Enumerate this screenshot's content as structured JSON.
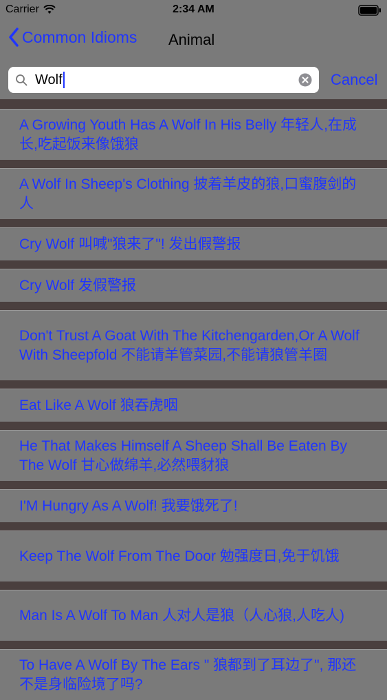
{
  "status_bar": {
    "carrier": "Carrier",
    "time": "2:34 AM"
  },
  "nav": {
    "back_label": "Common Idioms",
    "title": "Animal"
  },
  "search": {
    "value": "Wolf",
    "cancel_label": "Cancel"
  },
  "results": [
    "A Growing Youth Has A Wolf In His Belly  年轻人,在成长,吃起饭来像饿狼",
    "A Wolf In Sheep's Clothing 披着羊皮的狼,口蜜腹剑的人",
    "Cry Wolf 叫喊\"狼来了\"! 发出假警报",
    "Cry Wolf  发假警报",
    "Don't Trust A Goat With The Kitchengarden,Or A Wolf With Sheepfold  不能请羊管菜园,不能请狼管羊圈",
    "Eat Like A Wolf 狼吞虎咽",
    "He That Makes Himself A Sheep Shall Be Eaten By The Wolf  甘心做绵羊,必然喂豺狼",
    "I'M Hungry As A Wolf! 我要饿死了!",
    "Keep The Wolf From The Door  勉强度日,免于饥饿",
    "Man Is A Wolf To Man  人对人是狼（人心狼,人吃人)",
    "To Have A Wolf By The Ears \" 狼都到了耳边了\", 那还不是身临险境了吗?"
  ],
  "colors": {
    "accent": "#1f35ff",
    "row_background": "#7a7a7a",
    "separator": "#4a3f3e"
  }
}
